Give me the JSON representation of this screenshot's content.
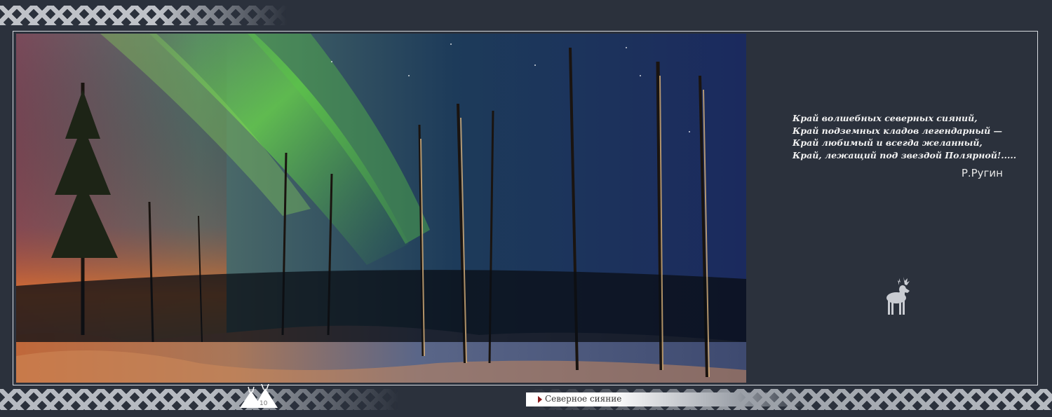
{
  "poem": {
    "lines": [
      "Край волшебных северных сияний,",
      "Край подземных кладов легендарный —",
      "Край любимый и всегда желанный,",
      "Край, лежащий под звездой Полярной!....."
    ],
    "author": "Р.Ругин"
  },
  "footer": {
    "page_number": "10",
    "section_title": "Северное сияние"
  },
  "photo": {
    "subject": "aurora-borealis-over-snowy-forest"
  },
  "colors": {
    "background": "#2b313c",
    "frame": "#d8dbe0",
    "aurora": "#5fd23a",
    "accent_arrow": "#8b1a1a"
  }
}
